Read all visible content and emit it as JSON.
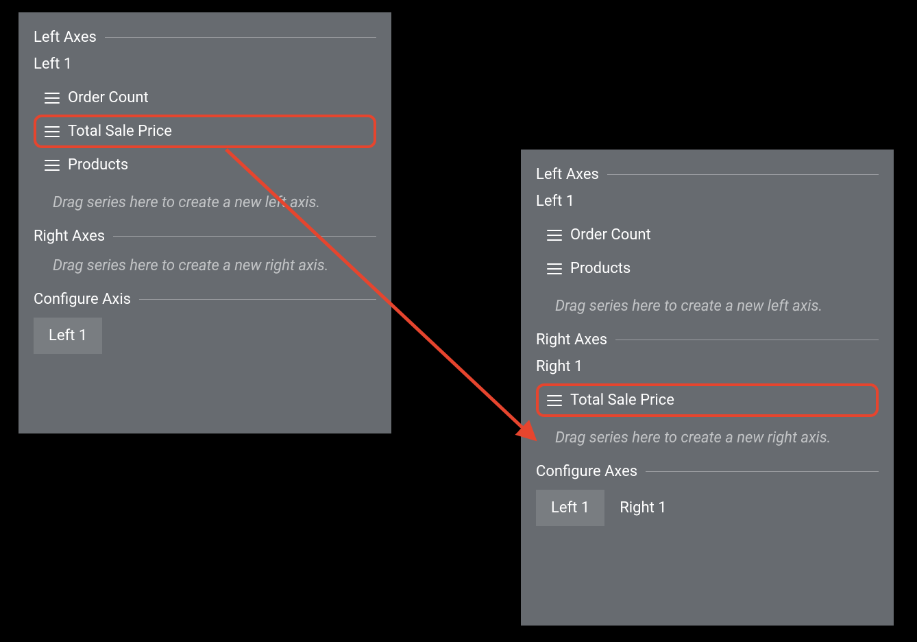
{
  "annotation": {
    "highlight_color": "#e6452e"
  },
  "panel_a": {
    "left_axes": {
      "title": "Left Axes",
      "axis_name": "Left 1",
      "series": [
        {
          "label": "Order Count",
          "highlight": false
        },
        {
          "label": "Total Sale Price",
          "highlight": true
        },
        {
          "label": "Products",
          "highlight": false
        }
      ],
      "drop_hint": "Drag series here to create a new left axis."
    },
    "right_axes": {
      "title": "Right Axes",
      "drop_hint": "Drag series here to create a new right axis."
    },
    "configure": {
      "title": "Configure Axis",
      "tabs": [
        {
          "label": "Left 1",
          "active": true
        }
      ]
    }
  },
  "panel_b": {
    "left_axes": {
      "title": "Left Axes",
      "axis_name": "Left 1",
      "series": [
        {
          "label": "Order Count",
          "highlight": false
        },
        {
          "label": "Products",
          "highlight": false
        }
      ],
      "drop_hint": "Drag series here to create a new left axis."
    },
    "right_axes": {
      "title": "Right Axes",
      "axis_name": "Right 1",
      "series": [
        {
          "label": "Total Sale Price",
          "highlight": true
        }
      ],
      "drop_hint": "Drag series here to create a new right axis."
    },
    "configure": {
      "title": "Configure Axes",
      "tabs": [
        {
          "label": "Left 1",
          "active": true
        },
        {
          "label": "Right 1",
          "active": false
        }
      ]
    }
  }
}
